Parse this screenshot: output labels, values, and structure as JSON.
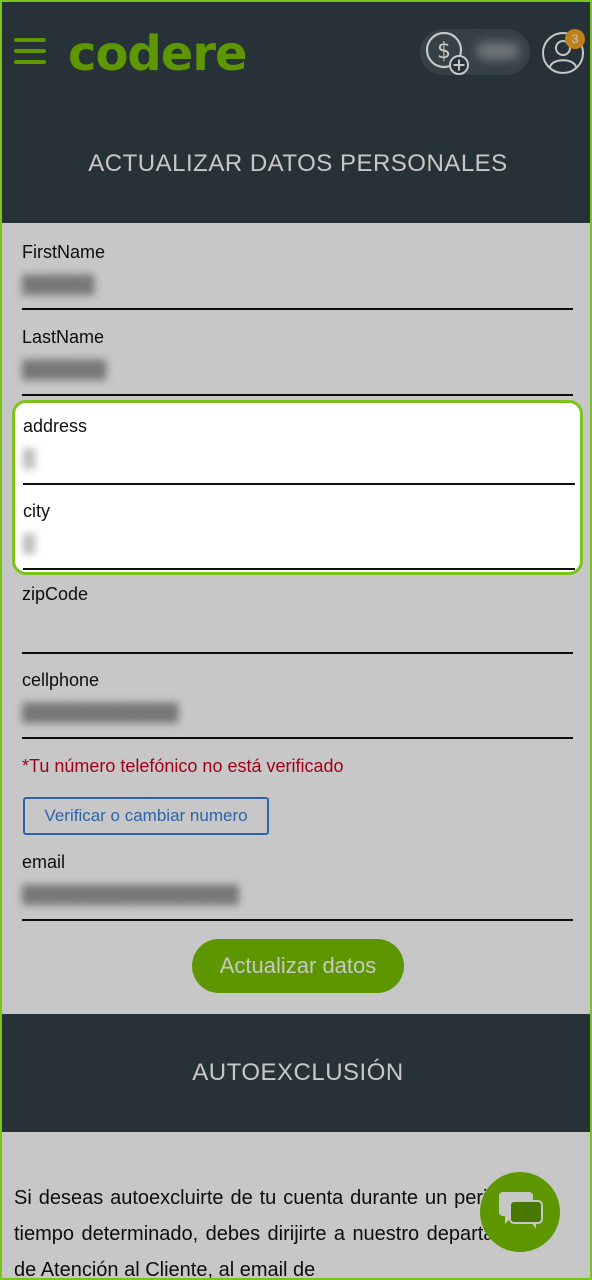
{
  "header": {
    "logo_text": "codere",
    "notifications_count": "3"
  },
  "sections": {
    "personal_title": "ACTUALIZAR DATOS PERSONALES",
    "autoexclusion_title": "AUTOEXCLUSIÓN"
  },
  "form": {
    "firstname_label": "FirstName",
    "lastname_label": "LastName",
    "address_label": "address",
    "city_label": "city",
    "zipcode_label": "zipCode",
    "cellphone_label": "cellphone",
    "email_label": "email",
    "phone_warning": "*Tu número telefónico no está verificado",
    "verify_button": "Verificar o cambiar numero",
    "update_button": "Actualizar datos"
  },
  "autoexclusion": {
    "text": "Si deseas autoexcluirte de tu cuenta durante un periodo de tiempo determinado, debes dirijirte a nuestro departamento de Atención al Cliente, al email de"
  },
  "colors": {
    "brand_green": "#79c000",
    "header_bg": "#333f48",
    "warning_red": "#d0021b",
    "link_blue": "#3d7fd6",
    "logo_magenta": "#a23aad"
  }
}
